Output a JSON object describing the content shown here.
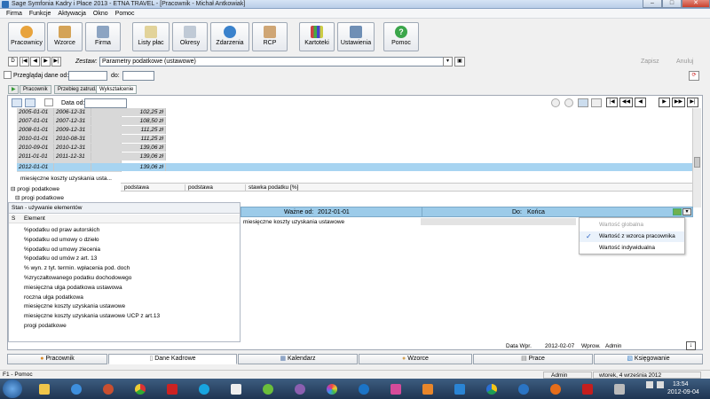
{
  "window": {
    "title": "Sage Symfonia Kadry i Płace 2013 - ETNA TRAVEL - [Pracownik - Michał Antkowiak]",
    "minimize": "–",
    "maximize": "□",
    "close": "✕"
  },
  "menu": [
    "Firma",
    "Funkcje",
    "Aktywacja",
    "Okno",
    "Pomoc"
  ],
  "toolbar": {
    "pracownicy": "Pracownicy",
    "wzorce": "Wzorce",
    "firma": "Firma",
    "listy_plac": "Listy płac",
    "okresy": "Okresy",
    "zdarzenia": "Zdarzenia",
    "rcp": "RCP",
    "kartoteki": "Kartoteki",
    "ustawienia": "Ustawienia",
    "pomoc": "Pomoc"
  },
  "nav": {
    "zestaw_label": "Zestaw:",
    "zestaw_value": "Parametry podatkowe (ustawowe)",
    "zapisz": "Zapisz",
    "anuluj": "Anuluj",
    "przegladaj_label": "Przeglądaj dane od:",
    "do_label": "do:"
  },
  "subtabs": [
    "Pracownik",
    "Przebieg zatrud.",
    "Wykształcenie"
  ],
  "panel": {
    "data_od_label": "Data od:",
    "rows": [
      {
        "from": "2005-01-01",
        "to": "2006-12-31",
        "value": "102,25 zł"
      },
      {
        "from": "2007-01-01",
        "to": "2007-12-31",
        "value": "108,50 zł"
      },
      {
        "from": "2008-01-01",
        "to": "2009-12-31",
        "value": "111,25 zł"
      },
      {
        "from": "2010-01-01",
        "to": "2010-08-31",
        "value": "111,25 zł"
      },
      {
        "from": "2010-09-01",
        "to": "2010-12-31",
        "value": "139,06 zł"
      },
      {
        "from": "2011-01-01",
        "to": "2011-12-31",
        "value": "139,06 zł"
      },
      {
        "from": "2012-01-01",
        "to": "",
        "value": "139,06 zł"
      }
    ],
    "tree": [
      "miesięczne koszty uzyskania usta...",
      "progi podatkowe",
      "progi podatkowe"
    ],
    "tree_headers": [
      "podstawa",
      "podstawa",
      "stawka podatku [%]"
    ],
    "stan_title": "Stan - używanie elementów",
    "stan_col_s": "S",
    "stan_col_el": "Element",
    "elements": [
      "%podatku od praw autorskich",
      "%podatku od umowy o dzieło",
      "%podatku od umowy zlecenia",
      "%podatku od umów z art. 13",
      "% wyn. z tyt. termin. wpłacenia pod. doch",
      "%zryczałtowanego podatku dochodowego",
      "miesięczna ulga podatkowa ustawowa",
      "roczna ulga podatkowa",
      "miesięczne koszty uzyskania ustawowe",
      "miesięczne koszty uzyskania ustawowe UCP z art.13",
      "progi podatkowe"
    ],
    "wazne_od": "Ważne od:",
    "wazne_od_value": "2012-01-01",
    "do": "Do:",
    "do_value": "Końca",
    "detail_row": "miesięczne koszty uzyskania ustawowe",
    "popup": [
      "Wartość globalna",
      "Wartość z wzorca pracownika",
      "Wartość indywidualna"
    ],
    "data_wpr_label": "Data Wpr.",
    "data_wpr_value": "2012-02-07",
    "wprow_label": "Wprow.",
    "wprow_value": "Admin"
  },
  "bottom_tabs": [
    "Pracownik",
    "Dane Kadrowe",
    "Kalendarz",
    "Wzorce",
    "Prace",
    "Księgowanie"
  ],
  "status": {
    "left": "F1 - Pomoc",
    "user": "Admin",
    "date": "wtorek, 4 września 2012"
  },
  "taskbar": {
    "time": "13:54",
    "date": "2012-09-04"
  },
  "colors": {
    "selected_row": "#a7d4f1",
    "header_blue": "#9ccbe9",
    "accent": "#2e6fb7"
  }
}
